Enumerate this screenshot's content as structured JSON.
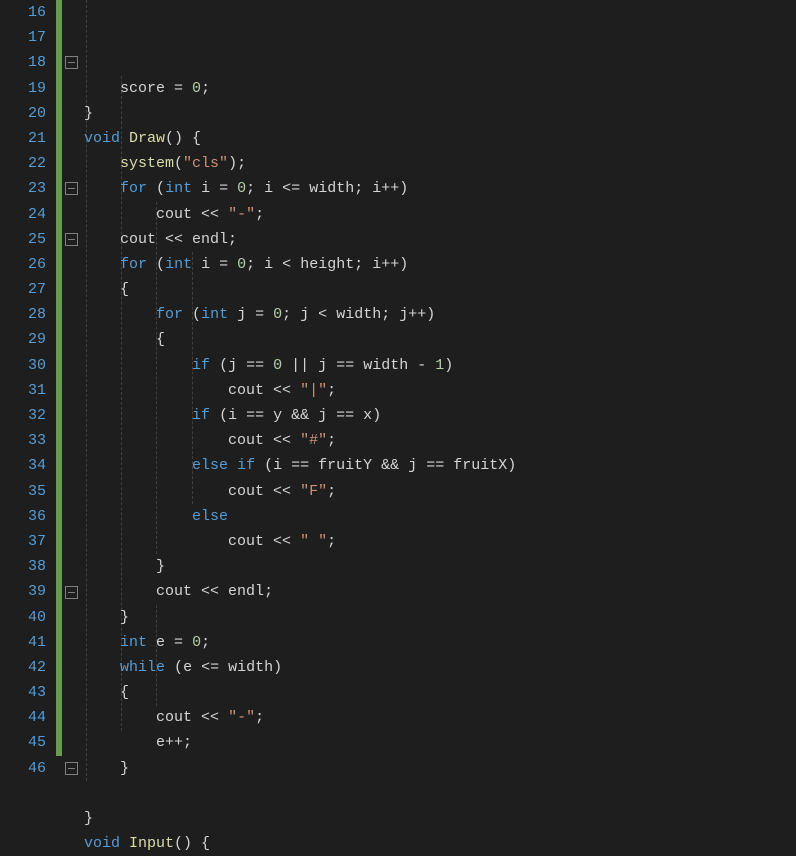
{
  "lines": [
    {
      "n": 16,
      "indent": 1,
      "tokens": [
        [
          "id",
          "    score "
        ],
        [
          "op",
          "="
        ],
        [
          "id",
          " "
        ],
        [
          "num",
          "0"
        ],
        [
          "pn",
          ";"
        ]
      ]
    },
    {
      "n": 17,
      "indent": 0,
      "tokens": [
        [
          "pn",
          "}"
        ]
      ]
    },
    {
      "n": 18,
      "indent": 0,
      "fold": "open",
      "tokens": [
        [
          "kw",
          "void"
        ],
        [
          "id",
          " "
        ],
        [
          "fn",
          "Draw"
        ],
        [
          "pn",
          "() {"
        ]
      ]
    },
    {
      "n": 19,
      "indent": 1,
      "tokens": [
        [
          "id",
          "    "
        ],
        [
          "fn",
          "system"
        ],
        [
          "pn",
          "("
        ],
        [
          "str",
          "\"cls\""
        ],
        [
          "pn",
          ");"
        ]
      ]
    },
    {
      "n": 20,
      "indent": 1,
      "tokens": [
        [
          "id",
          "    "
        ],
        [
          "kw",
          "for"
        ],
        [
          "id",
          " "
        ],
        [
          "pn",
          "("
        ],
        [
          "kw",
          "int"
        ],
        [
          "id",
          " i "
        ],
        [
          "op",
          "="
        ],
        [
          "id",
          " "
        ],
        [
          "num",
          "0"
        ],
        [
          "pn",
          "; "
        ],
        [
          "id",
          "i "
        ],
        [
          "op",
          "<="
        ],
        [
          "id",
          " width"
        ],
        [
          "pn",
          "; "
        ],
        [
          "id",
          "i"
        ],
        [
          "op",
          "++"
        ],
        [
          "pn",
          ")"
        ]
      ]
    },
    {
      "n": 21,
      "indent": 2,
      "tokens": [
        [
          "id",
          "        cout "
        ],
        [
          "op",
          "<<"
        ],
        [
          "id",
          " "
        ],
        [
          "str",
          "\"-\""
        ],
        [
          "pn",
          ";"
        ]
      ]
    },
    {
      "n": 22,
      "indent": 1,
      "tokens": [
        [
          "id",
          "    cout "
        ],
        [
          "op",
          "<<"
        ],
        [
          "id",
          " endl"
        ],
        [
          "pn",
          ";"
        ]
      ]
    },
    {
      "n": 23,
      "indent": 1,
      "fold": "open",
      "tokens": [
        [
          "id",
          "    "
        ],
        [
          "kw",
          "for"
        ],
        [
          "id",
          " "
        ],
        [
          "pn",
          "("
        ],
        [
          "kw",
          "int"
        ],
        [
          "id",
          " i "
        ],
        [
          "op",
          "="
        ],
        [
          "id",
          " "
        ],
        [
          "num",
          "0"
        ],
        [
          "pn",
          "; "
        ],
        [
          "id",
          "i "
        ],
        [
          "op",
          "<"
        ],
        [
          "id",
          " height"
        ],
        [
          "pn",
          "; "
        ],
        [
          "id",
          "i"
        ],
        [
          "op",
          "++"
        ],
        [
          "pn",
          ")"
        ]
      ]
    },
    {
      "n": 24,
      "indent": 1,
      "tokens": [
        [
          "id",
          "    "
        ],
        [
          "pn",
          "{"
        ]
      ]
    },
    {
      "n": 25,
      "indent": 2,
      "fold": "open",
      "tokens": [
        [
          "id",
          "        "
        ],
        [
          "kw",
          "for"
        ],
        [
          "id",
          " "
        ],
        [
          "pn",
          "("
        ],
        [
          "kw",
          "int"
        ],
        [
          "id",
          " j "
        ],
        [
          "op",
          "="
        ],
        [
          "id",
          " "
        ],
        [
          "num",
          "0"
        ],
        [
          "pn",
          "; "
        ],
        [
          "id",
          "j "
        ],
        [
          "op",
          "<"
        ],
        [
          "id",
          " width"
        ],
        [
          "pn",
          "; "
        ],
        [
          "id",
          "j"
        ],
        [
          "op",
          "++"
        ],
        [
          "pn",
          ")"
        ]
      ]
    },
    {
      "n": 26,
      "indent": 2,
      "tokens": [
        [
          "id",
          "        "
        ],
        [
          "pn",
          "{"
        ]
      ]
    },
    {
      "n": 27,
      "indent": 3,
      "tokens": [
        [
          "id",
          "            "
        ],
        [
          "kw",
          "if"
        ],
        [
          "id",
          " "
        ],
        [
          "pn",
          "("
        ],
        [
          "id",
          "j "
        ],
        [
          "op",
          "=="
        ],
        [
          "id",
          " "
        ],
        [
          "num",
          "0"
        ],
        [
          "id",
          " "
        ],
        [
          "op",
          "||"
        ],
        [
          "id",
          " j "
        ],
        [
          "op",
          "=="
        ],
        [
          "id",
          " width "
        ],
        [
          "op",
          "-"
        ],
        [
          "id",
          " "
        ],
        [
          "num",
          "1"
        ],
        [
          "pn",
          ")"
        ]
      ]
    },
    {
      "n": 28,
      "indent": 4,
      "tokens": [
        [
          "id",
          "                cout "
        ],
        [
          "op",
          "<<"
        ],
        [
          "id",
          " "
        ],
        [
          "str",
          "\"|\""
        ],
        [
          "pn",
          ";"
        ]
      ]
    },
    {
      "n": 29,
      "indent": 3,
      "tokens": [
        [
          "id",
          "            "
        ],
        [
          "kw",
          "if"
        ],
        [
          "id",
          " "
        ],
        [
          "pn",
          "("
        ],
        [
          "id",
          "i "
        ],
        [
          "op",
          "=="
        ],
        [
          "id",
          " y "
        ],
        [
          "op",
          "&&"
        ],
        [
          "id",
          " j "
        ],
        [
          "op",
          "=="
        ],
        [
          "id",
          " x"
        ],
        [
          "pn",
          ")"
        ]
      ]
    },
    {
      "n": 30,
      "indent": 4,
      "tokens": [
        [
          "id",
          "                cout "
        ],
        [
          "op",
          "<<"
        ],
        [
          "id",
          " "
        ],
        [
          "str",
          "\"#\""
        ],
        [
          "pn",
          ";"
        ]
      ]
    },
    {
      "n": 31,
      "indent": 3,
      "tokens": [
        [
          "id",
          "            "
        ],
        [
          "kw",
          "else"
        ],
        [
          "id",
          " "
        ],
        [
          "kw",
          "if"
        ],
        [
          "id",
          " "
        ],
        [
          "pn",
          "("
        ],
        [
          "id",
          "i "
        ],
        [
          "op",
          "=="
        ],
        [
          "id",
          " fruitY "
        ],
        [
          "op",
          "&&"
        ],
        [
          "id",
          " j "
        ],
        [
          "op",
          "=="
        ],
        [
          "id",
          " fruitX"
        ],
        [
          "pn",
          ")"
        ]
      ]
    },
    {
      "n": 32,
      "indent": 4,
      "tokens": [
        [
          "id",
          "                cout "
        ],
        [
          "op",
          "<<"
        ],
        [
          "id",
          " "
        ],
        [
          "str",
          "\"F\""
        ],
        [
          "pn",
          ";"
        ]
      ]
    },
    {
      "n": 33,
      "indent": 3,
      "tokens": [
        [
          "id",
          "            "
        ],
        [
          "kw",
          "else"
        ]
      ]
    },
    {
      "n": 34,
      "indent": 4,
      "tokens": [
        [
          "id",
          "                cout "
        ],
        [
          "op",
          "<<"
        ],
        [
          "id",
          " "
        ],
        [
          "str",
          "\" \""
        ],
        [
          "pn",
          ";"
        ]
      ]
    },
    {
      "n": 35,
      "indent": 2,
      "tokens": [
        [
          "id",
          "        "
        ],
        [
          "pn",
          "}"
        ]
      ]
    },
    {
      "n": 36,
      "indent": 2,
      "tokens": [
        [
          "id",
          "        cout "
        ],
        [
          "op",
          "<<"
        ],
        [
          "id",
          " endl"
        ],
        [
          "pn",
          ";"
        ]
      ]
    },
    {
      "n": 37,
      "indent": 1,
      "tokens": [
        [
          "id",
          "    "
        ],
        [
          "pn",
          "}"
        ]
      ]
    },
    {
      "n": 38,
      "indent": 1,
      "tokens": [
        [
          "id",
          "    "
        ],
        [
          "kw",
          "int"
        ],
        [
          "id",
          " e "
        ],
        [
          "op",
          "="
        ],
        [
          "id",
          " "
        ],
        [
          "num",
          "0"
        ],
        [
          "pn",
          ";"
        ]
      ]
    },
    {
      "n": 39,
      "indent": 1,
      "fold": "open",
      "tokens": [
        [
          "id",
          "    "
        ],
        [
          "kw",
          "while"
        ],
        [
          "id",
          " "
        ],
        [
          "pn",
          "("
        ],
        [
          "id",
          "e "
        ],
        [
          "op",
          "<="
        ],
        [
          "id",
          " width"
        ],
        [
          "pn",
          ")"
        ]
      ]
    },
    {
      "n": 40,
      "indent": 1,
      "tokens": [
        [
          "id",
          "    "
        ],
        [
          "pn",
          "{"
        ]
      ]
    },
    {
      "n": 41,
      "indent": 2,
      "tokens": [
        [
          "id",
          "        cout "
        ],
        [
          "op",
          "<<"
        ],
        [
          "id",
          " "
        ],
        [
          "str",
          "\"-\""
        ],
        [
          "pn",
          ";"
        ]
      ]
    },
    {
      "n": 42,
      "indent": 2,
      "tokens": [
        [
          "id",
          "        e"
        ],
        [
          "op",
          "++"
        ],
        [
          "pn",
          ";"
        ]
      ]
    },
    {
      "n": 43,
      "indent": 1,
      "tokens": [
        [
          "id",
          "    "
        ],
        [
          "pn",
          "}"
        ]
      ]
    },
    {
      "n": 44,
      "indent": 1,
      "tokens": []
    },
    {
      "n": 45,
      "indent": 0,
      "tokens": [
        [
          "pn",
          "}"
        ]
      ]
    },
    {
      "n": 46,
      "indent": 0,
      "fold": "open",
      "tokens": [
        [
          "kw",
          "void"
        ],
        [
          "id",
          " "
        ],
        [
          "fn",
          "Input"
        ],
        [
          "pn",
          "() {"
        ]
      ]
    }
  ],
  "indentGuides": [
    {
      "col": 0,
      "fromLine": 0,
      "toLine": 30
    },
    {
      "col": 1,
      "fromLine": 3,
      "toLine": 28
    },
    {
      "col": 2,
      "fromLine": 8,
      "toLine": 21
    },
    {
      "col": 3,
      "fromLine": 10,
      "toLine": 19
    },
    {
      "col": 2,
      "fromLine": 24,
      "toLine": 27
    }
  ],
  "colors": {
    "background": "#1e1e1e",
    "lineNumber": "#569cd6",
    "changeBar": "#6a9955",
    "keyword": "#569cd6",
    "function": "#dcdcaa",
    "number": "#b5cea8",
    "string": "#ce9178",
    "default": "#d4d4d4"
  }
}
